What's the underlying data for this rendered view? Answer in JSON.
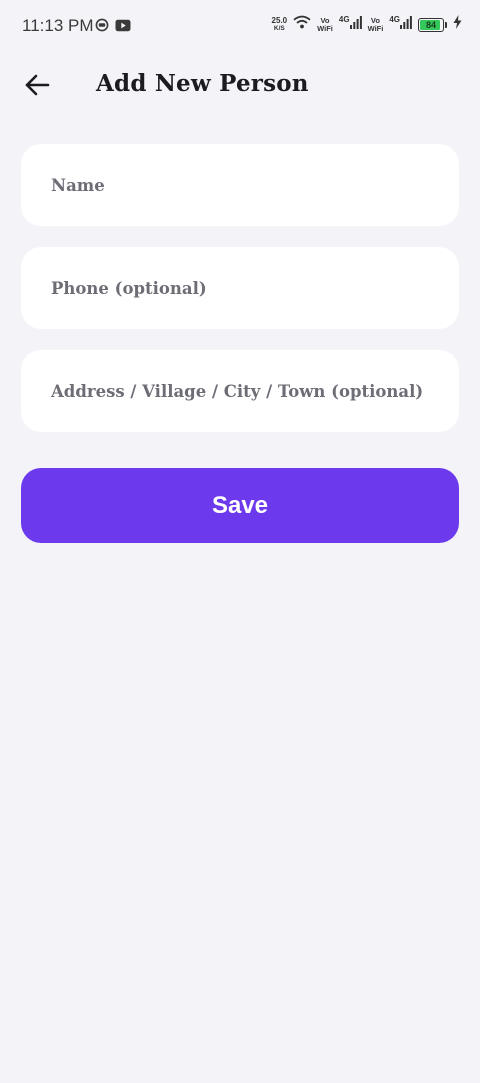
{
  "status_bar": {
    "time": "11:13 PM",
    "net_speed_value": "25.0",
    "net_speed_unit": "K/S",
    "sim1_vo": "Vo",
    "sim1_wifi": "WiFi",
    "sim1_net": "4G",
    "sim2_vo": "Vo",
    "sim2_wifi": "WiFi",
    "sim2_net": "4G",
    "battery_level": "84",
    "icons": [
      "chat-bubble-icon",
      "youtube-icon",
      "wifi-icon",
      "signal-icon",
      "signal-icon",
      "battery-icon",
      "charging-bolt-icon"
    ]
  },
  "header": {
    "back_icon": "arrow-left-icon",
    "title": "Add New Person"
  },
  "form": {
    "name_placeholder": "Name",
    "name_value": "",
    "phone_placeholder": "Phone (optional)",
    "phone_value": "",
    "address_placeholder": "Address / Village / City / Town (optional)",
    "address_value": "",
    "save_label": "Save"
  },
  "colors": {
    "background": "#f4f3f8",
    "field_background": "#ffffff",
    "accent": "#6c3aec",
    "battery_fill": "#34c759"
  }
}
